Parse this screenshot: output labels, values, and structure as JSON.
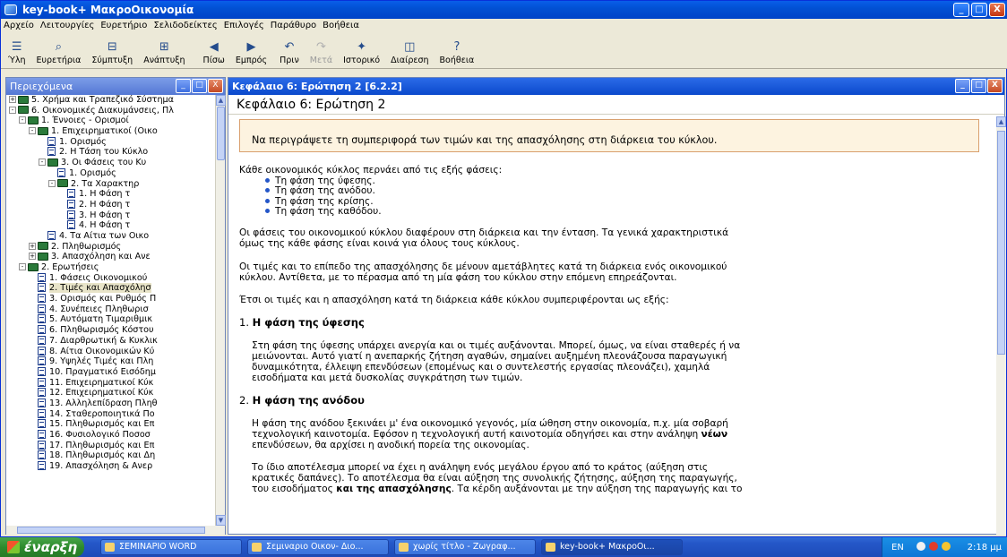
{
  "window": {
    "title": "key-book+  ΜακροΟικονομία",
    "caption_min": "_",
    "caption_max": "□",
    "caption_close": "X"
  },
  "menubar": [
    "Αρχείο",
    "Λειτουργίες",
    "Ευρετήριο",
    "Σελιδοδείκτες",
    "Επιλογές",
    "Παράθυρο",
    "Βοήθεια"
  ],
  "toolbar": [
    {
      "label": "Ύλη",
      "icon": "toc-icon",
      "glyph": "☰",
      "disabled": false
    },
    {
      "label": "Ευρετήρια",
      "icon": "search-icon",
      "glyph": "⌕",
      "disabled": false
    },
    {
      "label": "Σύμπτυξη",
      "icon": "collapse-icon",
      "glyph": "⊟",
      "disabled": false
    },
    {
      "label": "Ανάπτυξη",
      "icon": "expand-icon",
      "glyph": "⊞",
      "disabled": false
    },
    {
      "label": "Πίσω",
      "icon": "back-icon",
      "glyph": "◀",
      "disabled": false
    },
    {
      "label": "Εμπρός",
      "icon": "forward-icon",
      "glyph": "▶",
      "disabled": false
    },
    {
      "label": "Πριν",
      "icon": "undo-icon",
      "glyph": "↶",
      "disabled": false
    },
    {
      "label": "Μετά",
      "icon": "redo-icon",
      "glyph": "↷",
      "disabled": true
    },
    {
      "label": "Ιστορικό",
      "icon": "history-icon",
      "glyph": "✦",
      "disabled": false
    },
    {
      "label": "Διαίρεση",
      "icon": "split-icon",
      "glyph": "◫",
      "disabled": false
    },
    {
      "label": "Βοήθεια",
      "icon": "help-icon",
      "glyph": "?",
      "disabled": false
    }
  ],
  "left_pane": {
    "title": "Περιεχόμενα"
  },
  "tree": [
    {
      "level": 0,
      "toggle": "+",
      "kind": "book",
      "label": "5. Χρήμα και Τραπεζικό Σύστημα"
    },
    {
      "level": 0,
      "toggle": "-",
      "kind": "book",
      "label": "6. Οικονομικές Διακυμάνσεις, Πλ"
    },
    {
      "level": 1,
      "toggle": "-",
      "kind": "book",
      "label": "1. Έννοιες - Ορισμοί"
    },
    {
      "level": 2,
      "toggle": "-",
      "kind": "book",
      "label": "1. Επιχειρηματικοί (Οικο"
    },
    {
      "level": 3,
      "toggle": "",
      "kind": "page",
      "label": "1. Ορισμός"
    },
    {
      "level": 3,
      "toggle": "",
      "kind": "page",
      "label": "2. Η Τάση του Κύκλο"
    },
    {
      "level": 3,
      "toggle": "-",
      "kind": "book",
      "label": "3. Οι Φάσεις του Κυ"
    },
    {
      "level": 4,
      "toggle": "",
      "kind": "page",
      "label": "1. Ορισμός"
    },
    {
      "level": 4,
      "toggle": "-",
      "kind": "book",
      "label": "2. Τα Χαρακτηρ"
    },
    {
      "level": 5,
      "toggle": "",
      "kind": "page",
      "label": "1. Η Φάση τ"
    },
    {
      "level": 5,
      "toggle": "",
      "kind": "page",
      "label": "2. Η Φάση τ"
    },
    {
      "level": 5,
      "toggle": "",
      "kind": "page",
      "label": "3. Η Φάση τ"
    },
    {
      "level": 5,
      "toggle": "",
      "kind": "page",
      "label": "4. Η Φάση τ"
    },
    {
      "level": 3,
      "toggle": "",
      "kind": "page",
      "label": "4. Τα Αίτια των Οικο"
    },
    {
      "level": 2,
      "toggle": "+",
      "kind": "book",
      "label": "2. Πληθωρισμός"
    },
    {
      "level": 2,
      "toggle": "+",
      "kind": "book",
      "label": "3. Απασχόληση και Ανε"
    },
    {
      "level": 1,
      "toggle": "-",
      "kind": "book",
      "label": "2. Ερωτήσεις"
    },
    {
      "level": 2,
      "toggle": "",
      "kind": "page",
      "label": "1. Φάσεις Οικονομικού"
    },
    {
      "level": 2,
      "toggle": "",
      "kind": "page",
      "label": "2. Τιμές και Απασχόλησ",
      "selected": true
    },
    {
      "level": 2,
      "toggle": "",
      "kind": "page",
      "label": "3. Ορισμός και Ρυθμός Π"
    },
    {
      "level": 2,
      "toggle": "",
      "kind": "page",
      "label": "4. Συνέπειες Πληθωρισ"
    },
    {
      "level": 2,
      "toggle": "",
      "kind": "page",
      "label": "5. Αυτόματη Τιμαριθμικ"
    },
    {
      "level": 2,
      "toggle": "",
      "kind": "page",
      "label": "6. Πληθωρισμός Κόστου"
    },
    {
      "level": 2,
      "toggle": "",
      "kind": "page",
      "label": "7. Διαρθρωτική & Κυκλικ"
    },
    {
      "level": 2,
      "toggle": "",
      "kind": "page",
      "label": "8. Αίτια Οικονομικών Κύ"
    },
    {
      "level": 2,
      "toggle": "",
      "kind": "page",
      "label": "9. Υψηλές Τιμές και Πλη"
    },
    {
      "level": 2,
      "toggle": "",
      "kind": "page",
      "label": "10. Πραγματικό Εισόδημ"
    },
    {
      "level": 2,
      "toggle": "",
      "kind": "page",
      "label": "11. Επιχειρηματικοί Κύκ"
    },
    {
      "level": 2,
      "toggle": "",
      "kind": "page",
      "label": "12. Επιχειρηματικοί Κύκ"
    },
    {
      "level": 2,
      "toggle": "",
      "kind": "page",
      "label": "13. Αλληλεπίδραση Πληθ"
    },
    {
      "level": 2,
      "toggle": "",
      "kind": "page",
      "label": "14. Σταθεροποιητικά Πο"
    },
    {
      "level": 2,
      "toggle": "",
      "kind": "page",
      "label": "15. Πληθωρισμός και Επ"
    },
    {
      "level": 2,
      "toggle": "",
      "kind": "page",
      "label": "16. Φυσιολογικό Ποσοσ"
    },
    {
      "level": 2,
      "toggle": "",
      "kind": "page",
      "label": "17. Πληθωρισμός και Επ"
    },
    {
      "level": 2,
      "toggle": "",
      "kind": "page",
      "label": "18. Πληθωρισμός και Δη"
    },
    {
      "level": 2,
      "toggle": "",
      "kind": "page",
      "label": "19. Απασχόληση & Ανερ"
    }
  ],
  "right_pane": {
    "title": "Κεφάλαιο 6: Ερώτηση 2   [6.2.2]"
  },
  "doc": {
    "heading": "Κεφάλαιο 6: Ερώτηση 2",
    "question": "Να περιγράψετε τη συμπεριφορά των τιμών και της απασχόλησης στη διάρκεια του κύκλου.",
    "intro": "Κάθε οικονομικός κύκλος περνάει από τις εξής φάσεις:",
    "bullets": [
      "Τη φάση της ύφεσης.",
      "Τη φάση της ανόδου.",
      "Τη φάση της κρίσης.",
      "Τη φάση της καθόδου."
    ],
    "p1a": "Οι φάσεις του οικονομικού κύκλου διαφέρουν στη διάρκεια και την ένταση. Τα γενικά χαρακτηριστικά",
    "p1b": "όμως της κάθε φάσης είναι κοινά για όλους τους κύκλους.",
    "p2a": "Οι τιμές και το επίπεδο της απασχόλησης δε μένουν αμετάβλητες κατά τη διάρκεια ενός οικονομικού",
    "p2b": "κύκλου. Αντίθετα, με το πέρασμα από τη μία φάση του κύκλου στην επόμενη επηρεάζονται.",
    "p3": "Έτσι οι τιμές και η απασχόληση κατά τη διάρκεια κάθε κύκλου συμπεριφέρονται ως εξής:",
    "h1_num": "1.",
    "h1": "Η φάση της ύφεσης",
    "s1a": "Στη φάση της ύφεσης υπάρχει ανεργία και οι τιμές αυξάνονται. Μπορεί, όμως, να είναι σταθερές ή να",
    "s1b": "μειώνονται. Αυτό γιατί η ανεπαρκής ζήτηση αγαθών, σημαίνει αυξημένη πλεονάζουσα παραγωγική",
    "s1c": "δυναμικότητα, έλλειψη επενδύσεων (επομένως και ο συντελεστής εργασίας πλεονάζει), χαμηλά",
    "s1d": "εισοδήματα και μετά δυσκολίας συγκράτηση των τιμών.",
    "h2_num": "2.",
    "h2": "Η φάση της ανόδου",
    "s2a": "Η φάση της ανόδου ξεκινάει μ' ένα οικονομικό γεγονός, μία ώθηση στην οικονομία, π.χ. μία σοβαρή",
    "s2b": "τεχνολογική καινοτομία. Εφόσον η τεχνολογική αυτή καινοτομία οδηγήσει και στην ανάληψη",
    "s2b_bold": "νέων",
    "s2c": "επενδύσεων, θα αρχίσει η ανοδική πορεία της οικονομίας.",
    "s3a": "Το ίδιο αποτέλεσμα μπορεί να έχει η ανάληψη ενός μεγάλου έργου από το κράτος (αύξηση στις",
    "s3b": "κρατικές δαπάνες). Το αποτέλεσμα θα είναι αύξηση της συνολικής ζήτησης, αύξηση της παραγωγής,",
    "s3c_pre": "του εισοδήματος",
    "s3c_bold": "και της απασχόλησης",
    "s3c_post": ". Τα κέρδη αυξάνονται με την αύξηση της παραγωγής και το"
  },
  "taskbar": {
    "start": "έναρξη",
    "tasks": [
      "ΣΕΜΙΝΑΡΙΟ WORD",
      "Σεμιναριο Οικον- Διο...",
      "χωρίς τίτλο - Ζωγραφ...",
      "key-book+  ΜακροΟι..."
    ],
    "lang": "EN",
    "clock": "2:18 μμ"
  },
  "colors": {
    "title_blue": "#0a5ee9",
    "question_bg": "#fdf3e0",
    "bullet": "#2456c8",
    "taskbar": "#2557c8",
    "start": "#2d8a2d"
  }
}
